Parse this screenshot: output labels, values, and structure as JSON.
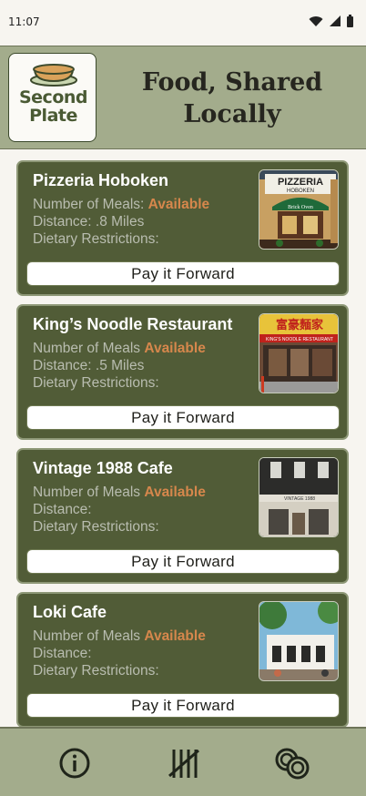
{
  "status": {
    "time": "11:07"
  },
  "header": {
    "logo_line1": "Second",
    "logo_line2": "Plate",
    "title_line1": "Food, Shared",
    "title_line2": "Locally"
  },
  "cards": [
    {
      "name": "Pizzeria Hoboken",
      "meals_label": "Number of Meals:",
      "meals_value": "Available",
      "distance": "Distance: .8 Miles",
      "dietary": "Dietary Restrictions:",
      "button": "Pay it Forward"
    },
    {
      "name": "King’s Noodle Restaurant",
      "meals_label": "Number of Meals",
      "meals_value": "Available",
      "distance": "Distance: .5 Miles",
      "dietary": "Dietary Restrictions:",
      "button": "Pay it Forward"
    },
    {
      "name": "Vintage 1988 Cafe",
      "meals_label": "Number of Meals",
      "meals_value": "Available",
      "distance": "Distance:",
      "dietary": "Dietary Restrictions:",
      "button": "Pay it Forward"
    },
    {
      "name": "Loki Cafe",
      "meals_label": "Number of Meals",
      "meals_value": "Available",
      "distance": "Distance:",
      "dietary": "Dietary Restrictions:",
      "button": "Pay it Forward"
    }
  ],
  "photos": {
    "pizzeria_sign": "PIZZERIA",
    "pizzeria_sub": "HOBOKEN",
    "pizzeria_awning": "Brick Oven",
    "kings_sign": "富豪麵家",
    "kings_sub": "KING'S NOODLE RESTAURANT",
    "vintage_sign": "VINTAGE 1988"
  },
  "nav": {
    "items": [
      "info-icon",
      "tally-icon",
      "plates-icon"
    ]
  },
  "colors": {
    "accent": "#d6874c",
    "card": "#515c37",
    "header": "#a3ac8c"
  }
}
